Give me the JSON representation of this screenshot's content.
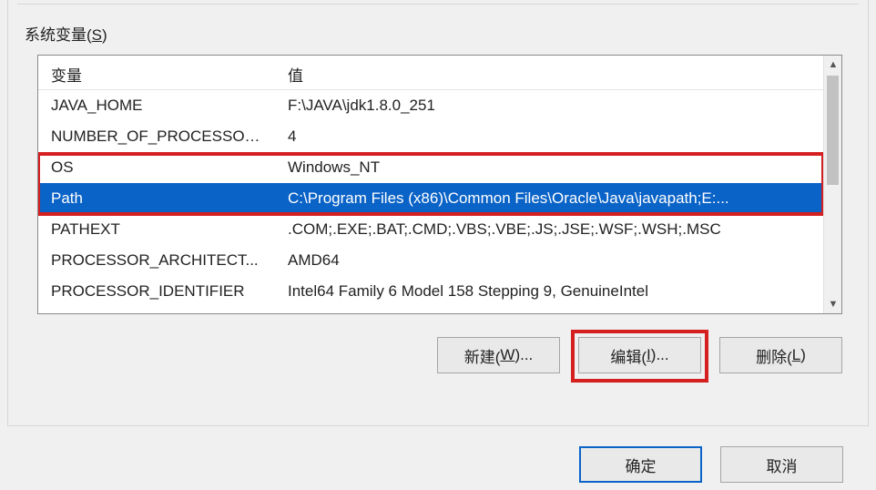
{
  "group": {
    "label_prefix": "系统变量(",
    "label_hotkey": "S",
    "label_suffix": ")"
  },
  "columns": {
    "name": "变量",
    "value": "值"
  },
  "rows": [
    {
      "name": "JAVA_HOME",
      "value": "F:\\JAVA\\jdk1.8.0_251",
      "selected": false
    },
    {
      "name": "NUMBER_OF_PROCESSORS",
      "value": "4",
      "selected": false
    },
    {
      "name": "OS",
      "value": "Windows_NT",
      "selected": false
    },
    {
      "name": "Path",
      "value": "C:\\Program Files (x86)\\Common Files\\Oracle\\Java\\javapath;E:...",
      "selected": true
    },
    {
      "name": "PATHEXT",
      "value": ".COM;.EXE;.BAT;.CMD;.VBS;.VBE;.JS;.JSE;.WSF;.WSH;.MSC",
      "selected": false
    },
    {
      "name": "PROCESSOR_ARCHITECT...",
      "value": "AMD64",
      "selected": false
    },
    {
      "name": "PROCESSOR_IDENTIFIER",
      "value": "Intel64 Family 6 Model 158 Stepping 9, GenuineIntel",
      "selected": false
    }
  ],
  "buttons": {
    "new_pre": "新建(",
    "new_hot": "W",
    "new_post": ")...",
    "edit_pre": "编辑(",
    "edit_hot": "I",
    "edit_post": ")...",
    "delete_pre": "删除(",
    "delete_hot": "L",
    "delete_post": ")"
  },
  "footer": {
    "ok": "确定",
    "cancel": "取消"
  }
}
